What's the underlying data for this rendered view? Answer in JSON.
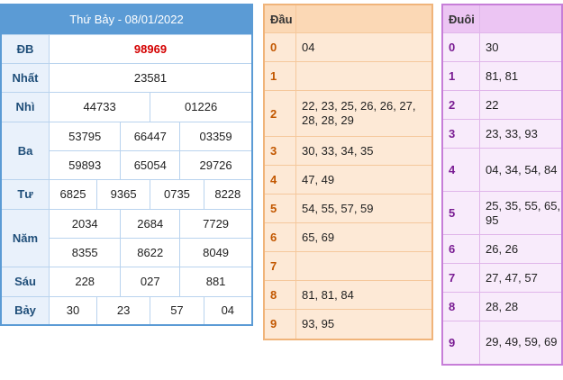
{
  "results": {
    "title": "Thứ Bảy - 08/01/2022",
    "rows": [
      {
        "label": "ĐB",
        "values": [
          "98969"
        ]
      },
      {
        "label": "Nhất",
        "values": [
          "23581"
        ]
      },
      {
        "label": "Nhì",
        "values": [
          "44733",
          "01226"
        ]
      },
      {
        "label": "Ba",
        "values": [
          "53795",
          "66447",
          "03359",
          "59893",
          "65054",
          "29726"
        ]
      },
      {
        "label": "Tư",
        "values": [
          "6825",
          "9365",
          "0735",
          "8228"
        ]
      },
      {
        "label": "Năm",
        "values": [
          "2034",
          "2684",
          "7729",
          "8355",
          "8622",
          "8049"
        ]
      },
      {
        "label": "Sáu",
        "values": [
          "228",
          "027",
          "881"
        ]
      },
      {
        "label": "Bảy",
        "values": [
          "30",
          "23",
          "57",
          "04"
        ]
      }
    ]
  },
  "head": {
    "title": "Đầu",
    "rows": [
      {
        "digit": "0",
        "values": "04"
      },
      {
        "digit": "1",
        "values": ""
      },
      {
        "digit": "2",
        "values": "22, 23, 25, 26, 26, 27, 28, 28, 29"
      },
      {
        "digit": "3",
        "values": "30, 33, 34, 35"
      },
      {
        "digit": "4",
        "values": "47, 49"
      },
      {
        "digit": "5",
        "values": "54, 55, 57, 59"
      },
      {
        "digit": "6",
        "values": "65, 69"
      },
      {
        "digit": "7",
        "values": ""
      },
      {
        "digit": "8",
        "values": "81, 81, 84"
      },
      {
        "digit": "9",
        "values": "93, 95"
      }
    ]
  },
  "tail": {
    "title": "Đuôi",
    "rows": [
      {
        "digit": "0",
        "values": "30"
      },
      {
        "digit": "1",
        "values": "81, 81"
      },
      {
        "digit": "2",
        "values": "22"
      },
      {
        "digit": "3",
        "values": "23, 33, 93"
      },
      {
        "digit": "4",
        "values": "04, 34, 54, 84"
      },
      {
        "digit": "5",
        "values": "25, 35, 55, 65, 95"
      },
      {
        "digit": "6",
        "values": "26, 26"
      },
      {
        "digit": "7",
        "values": "27, 47, 57"
      },
      {
        "digit": "8",
        "values": "28, 28"
      },
      {
        "digit": "9",
        "values": "29, 49, 59, 69"
      }
    ]
  },
  "colors": {
    "result_header": "#5b9bd5",
    "special_prize": "#d40000",
    "head_accent": "#f0b47a",
    "tail_accent": "#c77ed8"
  }
}
